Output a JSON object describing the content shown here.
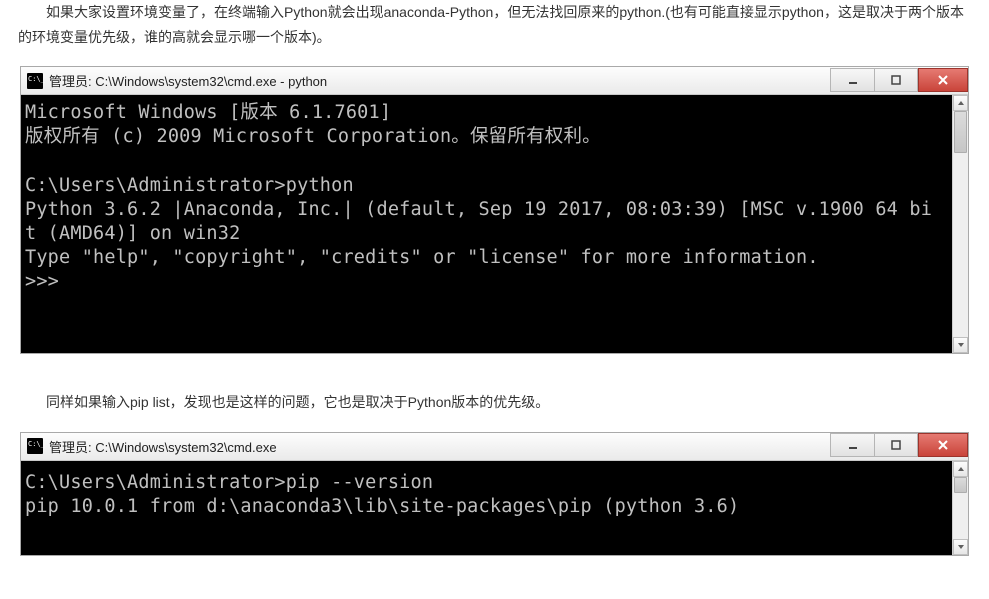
{
  "para1": "如果大家设置环境变量了，在终端输入Python就会出现anaconda-Python，但无法找回原来的python.(也有可能直接显示python，这是取决于两个版本的环境变量优先级，谁的高就会显示哪一个版本)。",
  "para2": "同样如果输入pip list，发现也是这样的问题，它也是取决于Python版本的优先级。",
  "terminal1": {
    "title": "管理员: C:\\Windows\\system32\\cmd.exe - python",
    "lines": [
      "Microsoft Windows [版本 6.1.7601]",
      "版权所有 (c) 2009 Microsoft Corporation。保留所有权利。",
      "",
      "C:\\Users\\Administrator>python",
      "Python 3.6.2 |Anaconda, Inc.| (default, Sep 19 2017, 08:03:39) [MSC v.1900 64 bi",
      "t (AMD64)] on win32",
      "Type \"help\", \"copyright\", \"credits\" or \"license\" for more information.",
      ">>>"
    ]
  },
  "terminal2": {
    "title": "管理员: C:\\Windows\\system32\\cmd.exe",
    "lines": [
      "C:\\Users\\Administrator>pip --version",
      "pip 10.0.1 from d:\\anaconda3\\lib\\site-packages\\pip (python 3.6)"
    ]
  }
}
